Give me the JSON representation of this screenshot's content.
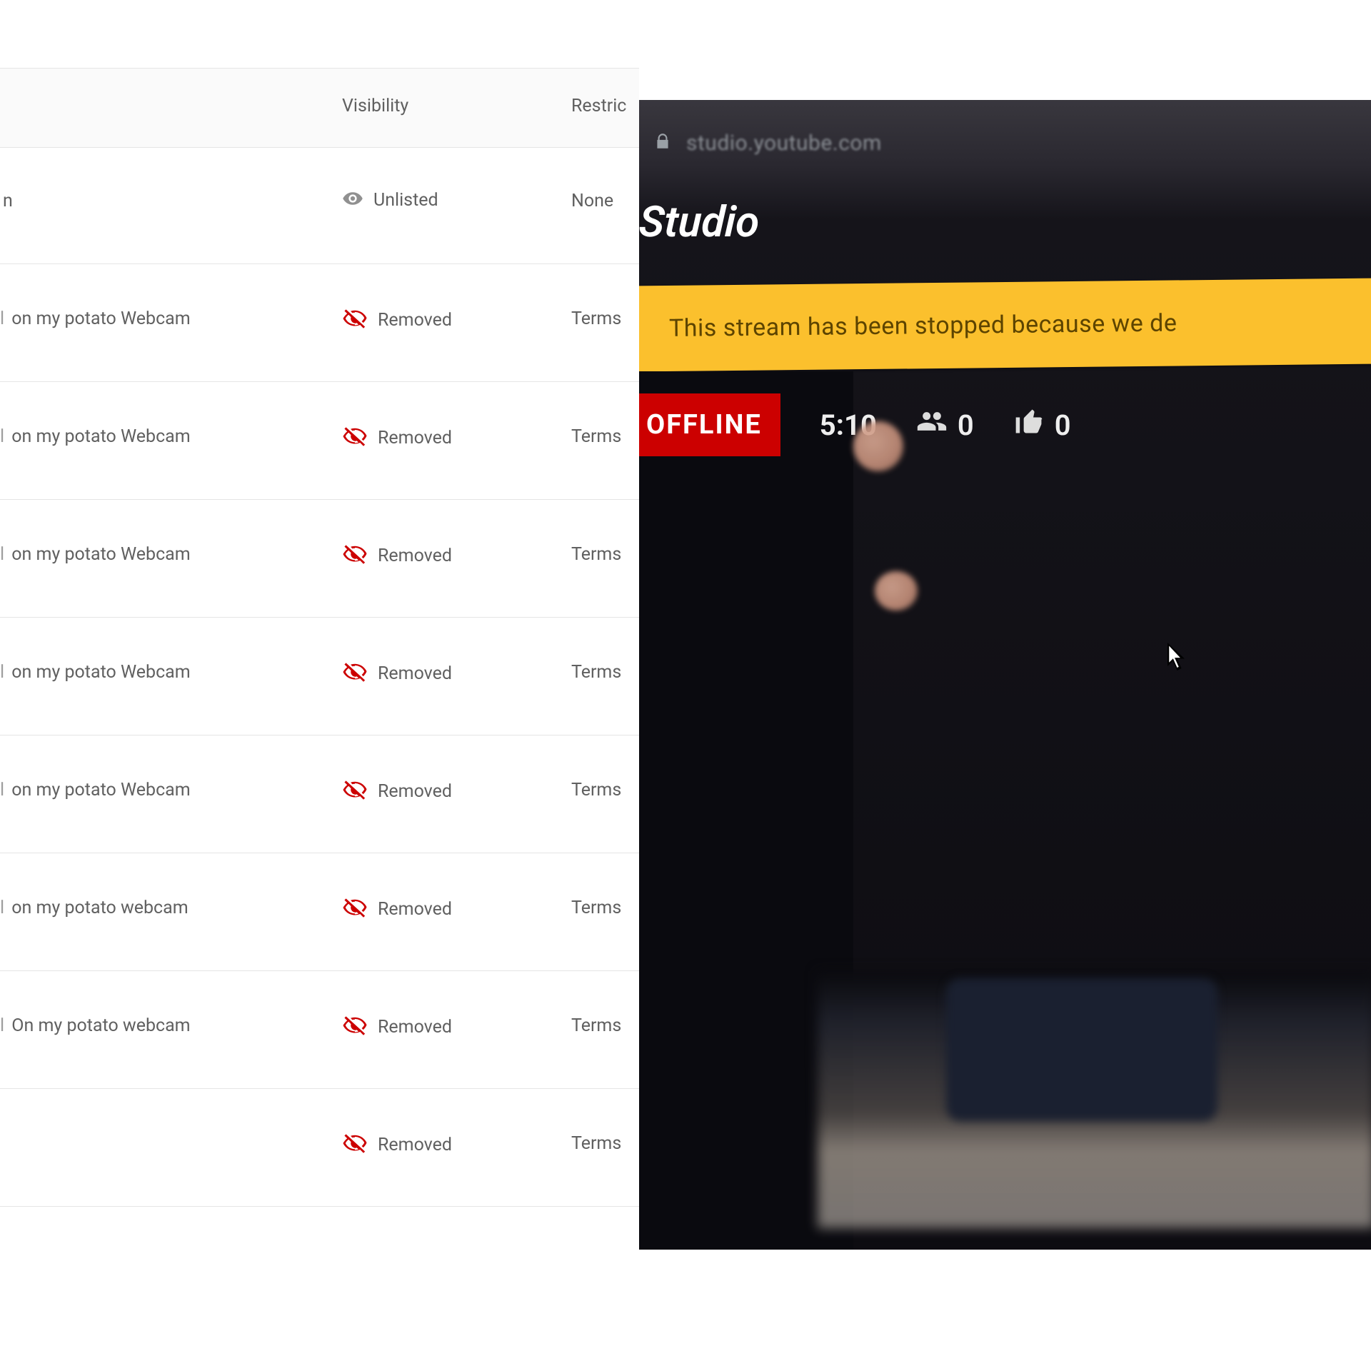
{
  "table": {
    "headers": {
      "visibility": "Visibility",
      "restrictions": "Restric"
    },
    "rows": [
      {
        "title_suffix": "n",
        "prefix_bar": false,
        "visibility_label": "Unlisted",
        "visibility_type": "unlisted",
        "restriction": "None"
      },
      {
        "title_suffix": "on my potato Webcam",
        "prefix_bar": true,
        "visibility_label": "Removed",
        "visibility_type": "removed",
        "restriction": "Terms"
      },
      {
        "title_suffix": "on my potato Webcam",
        "prefix_bar": true,
        "visibility_label": "Removed",
        "visibility_type": "removed",
        "restriction": "Terms"
      },
      {
        "title_suffix": "on my potato Webcam",
        "prefix_bar": true,
        "visibility_label": "Removed",
        "visibility_type": "removed",
        "restriction": "Terms"
      },
      {
        "title_suffix": "on my potato Webcam",
        "prefix_bar": true,
        "visibility_label": "Removed",
        "visibility_type": "removed",
        "restriction": "Terms"
      },
      {
        "title_suffix": "on my potato Webcam",
        "prefix_bar": true,
        "visibility_label": "Removed",
        "visibility_type": "removed",
        "restriction": "Terms"
      },
      {
        "title_suffix": "on my potato webcam",
        "prefix_bar": true,
        "visibility_label": "Removed",
        "visibility_type": "removed",
        "restriction": "Terms"
      },
      {
        "title_suffix": "On my potato webcam",
        "prefix_bar": true,
        "visibility_label": "Removed",
        "visibility_type": "removed",
        "restriction": "Terms"
      },
      {
        "title_suffix": "",
        "prefix_bar": false,
        "visibility_label": "Removed",
        "visibility_type": "removed",
        "restriction": "Terms"
      }
    ]
  },
  "live": {
    "address_url": "studio.youtube.com",
    "studio_word_partial": "Studio",
    "banner_message": "This stream has been stopped because we de",
    "offline_label": "OFFLINE",
    "elapsed": "5:10",
    "viewers": "0",
    "likes": "0"
  }
}
